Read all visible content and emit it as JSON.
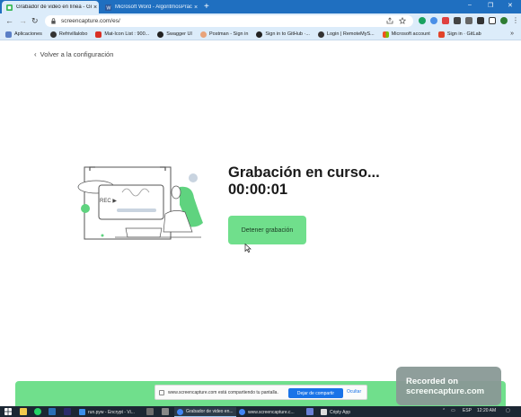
{
  "browser": {
    "tabs": [
      {
        "title": "Grabador de video en línea - Gra",
        "active": true
      },
      {
        "title": "Microsoft Word - AlgoritmosPrácticos",
        "active": false
      }
    ],
    "new_tab": "+",
    "close_glyph": "×",
    "window_controls": [
      "–",
      "❐",
      "✕"
    ],
    "url": "screencapture.com/es/",
    "nav": {
      "back": "←",
      "forward": "→",
      "reload": "↻"
    },
    "menu_glyph": "⋮"
  },
  "bookmarks": [
    {
      "label": "Aplicaciones",
      "color": "#5b7fc6"
    },
    {
      "label": "Refrivillalobo",
      "color": "#333333"
    },
    {
      "label": "Mat-Icon List : 900...",
      "color": "#d93025"
    },
    {
      "label": "Swagger UI",
      "color": "#222222"
    },
    {
      "label": "Postman - Sign in",
      "color": "#e8a37a"
    },
    {
      "label": "Sign in to GitHub ·...",
      "color": "#222222"
    },
    {
      "label": "Login | RemoteMyS...",
      "color": "#333333"
    },
    {
      "label": "Microsoft account",
      "color": "#f25022"
    },
    {
      "label": "Sign in · GitLab",
      "color": "#e24329"
    }
  ],
  "bookmarks_more": "»",
  "page": {
    "back_chevron": "‹",
    "back_label": "Volver a la configuración",
    "status_title": "Grabación en curso...",
    "timer": "00:00:01",
    "stop_button": "Detener grabación",
    "illustration_label": "REC ▶"
  },
  "share_bar": {
    "text": "www.screencapture.com está compartiendo tu pantalla.",
    "share_button": "Dejar de compartir",
    "hide_button": "Ocultar"
  },
  "badge": {
    "line1": "Recorded on",
    "line2": "screencapture.com"
  },
  "taskbar": {
    "items": [
      {
        "label": "run.pyw - Encrypt - Vi...",
        "color": "#3b8eea",
        "active": false
      },
      {
        "label": "Grabador de video en...",
        "color": "#4285f4",
        "active": true
      },
      {
        "label": "www.screencapture.c...",
        "color": "#4285f4",
        "active": false
      },
      {
        "label": "Cripty App",
        "color": "#dddddd",
        "active": false
      }
    ],
    "language": "ESP",
    "time": "12:20 AM"
  },
  "colors": {
    "accent_green": "#70df8c",
    "tab_strip": "#1f6fc0",
    "share_blue": "#1a73e8"
  }
}
